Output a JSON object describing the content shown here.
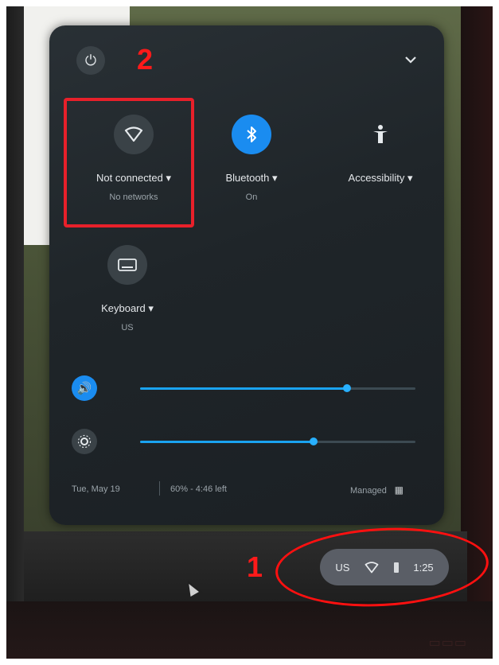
{
  "header": {
    "power_icon": "power-icon",
    "collapse_icon": "chevron-down-icon"
  },
  "tiles": [
    {
      "label": "Not connected ▾",
      "sublabel": "No networks",
      "icon": "wifi-icon",
      "active": false
    },
    {
      "label": "Bluetooth ▾",
      "sublabel": "On",
      "icon": "bluetooth-icon",
      "active": true
    },
    {
      "label": "Accessibility ▾",
      "sublabel": "",
      "icon": "accessibility-icon",
      "active": false
    },
    {
      "label": "Keyboard ▾",
      "sublabel": "US",
      "icon": "keyboard-icon",
      "active": false
    }
  ],
  "sliders": {
    "volume": {
      "icon": "volume-icon",
      "level": 0.75
    },
    "brightness": {
      "icon": "brightness-icon",
      "level": 0.63
    }
  },
  "footer": {
    "date": "Tue, May 19",
    "battery": "60% - 4:46 left",
    "managed": "Managed"
  },
  "tray": {
    "lang": "US",
    "time": "1:25"
  },
  "annotations": {
    "one": "1",
    "two": "2"
  },
  "colors": {
    "accent": "#1a8cf0",
    "annotation": "#e8202a"
  }
}
